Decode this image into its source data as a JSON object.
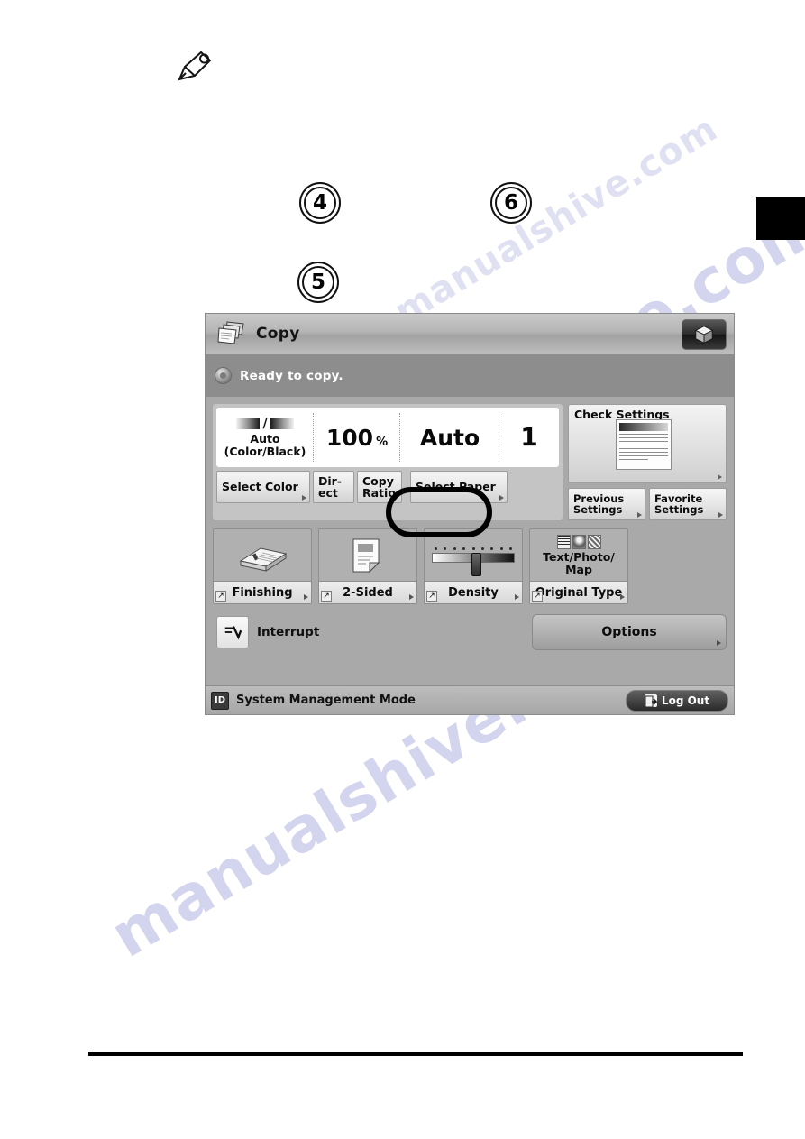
{
  "page": {
    "note_icon": "pencil-icon",
    "side_tab": "chapter-tab",
    "callouts": [
      {
        "number": "4"
      },
      {
        "number": "5"
      },
      {
        "number": "6"
      }
    ],
    "watermark": "manualshive.com"
  },
  "lcd": {
    "title_bar": {
      "icon": "copy-documents-icon",
      "title": "Copy",
      "cube_button_icon": "cube-icon"
    },
    "status": {
      "icon": "status-indicator-icon",
      "text": "Ready to copy."
    },
    "settings": {
      "values": [
        {
          "name": "color-mode",
          "icon": "color-black-gradient-icon",
          "line1": "Auto",
          "line2": "(Color/Black)"
        },
        {
          "name": "copy-ratio",
          "value": "100",
          "unit": "%"
        },
        {
          "name": "paper-size",
          "value": "Auto"
        },
        {
          "name": "copy-count",
          "value": "1"
        }
      ],
      "keys": [
        {
          "name": "select-color",
          "label": "Select Color"
        },
        {
          "name": "direct",
          "label": "Dir-\nect"
        },
        {
          "name": "copy-ratio",
          "label": "Copy\nRatio"
        },
        {
          "name": "select-paper",
          "label": "Select Paper",
          "highlighted": true
        }
      ],
      "check_settings": {
        "label": "Check Settings",
        "thumbnail": "document-preview-icon"
      },
      "sub_keys": [
        {
          "name": "previous-settings",
          "line1": "Previous",
          "line2": "Settings"
        },
        {
          "name": "favorite-settings",
          "line1": "Favorite",
          "line2": "Settings"
        }
      ]
    },
    "functions": [
      {
        "name": "finishing",
        "icon": "stapled-book-icon",
        "label": "Finishing"
      },
      {
        "name": "two-sided",
        "icon": "two-sided-page-icon",
        "label": "2-Sided"
      },
      {
        "name": "density",
        "icon": "density-slider-icon",
        "label": "Density"
      },
      {
        "name": "original-type",
        "icon": "text-photo-map-icon",
        "value": "Text/Photo/\nMap",
        "label": "Original Type"
      }
    ],
    "actions": {
      "interrupt": {
        "icon": "interrupt-icon",
        "label": "Interrupt"
      },
      "options": {
        "label": "Options"
      }
    },
    "footer": {
      "id_badge": "ID",
      "text": "System Management Mode",
      "logout": {
        "icon": "logout-icon",
        "label": "Log Out"
      }
    }
  }
}
